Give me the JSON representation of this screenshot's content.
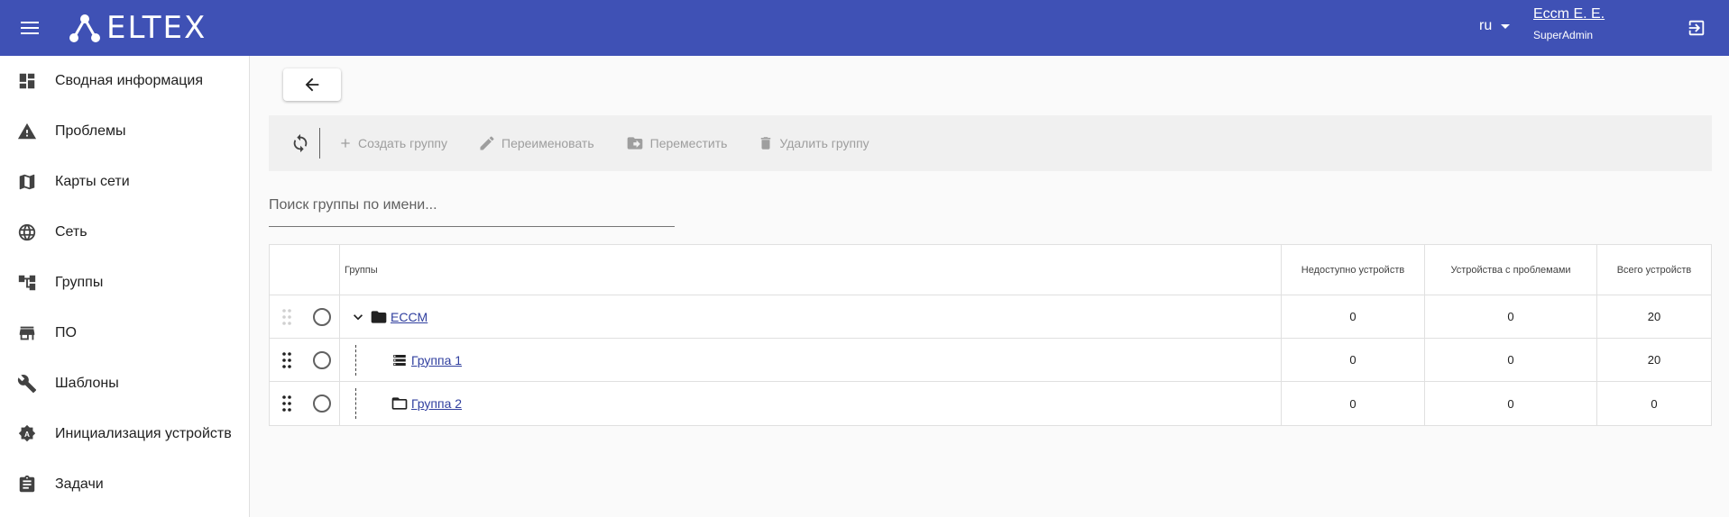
{
  "header": {
    "logo_text": "ELTEX",
    "language": "ru",
    "user_name": "Eccm E. E.",
    "user_role": "SuperAdmin"
  },
  "sidebar": {
    "items": [
      {
        "label": "Сводная информация",
        "icon": "dashboard-icon"
      },
      {
        "label": "Проблемы",
        "icon": "warning-icon"
      },
      {
        "label": "Карты сети",
        "icon": "map-icon"
      },
      {
        "label": "Сеть",
        "icon": "globe-icon"
      },
      {
        "label": "Группы",
        "icon": "groups-tree-icon"
      },
      {
        "label": "ПО",
        "icon": "store-icon"
      },
      {
        "label": "Шаблоны",
        "icon": "wrench-icon"
      },
      {
        "label": "Инициализация устройств",
        "icon": "settings-a-icon"
      },
      {
        "label": "Задачи",
        "icon": "clipboard-icon"
      }
    ]
  },
  "toolbar": {
    "create_label": "Создать группу",
    "rename_label": "Переименовать",
    "move_label": "Переместить",
    "delete_label": "Удалить группу"
  },
  "search": {
    "placeholder": "Поиск группы по имени..."
  },
  "table": {
    "headers": {
      "groups": "Группы",
      "unavailable": "Недоступно устройств",
      "problems": "Устройства с проблемами",
      "total": "Всего устройств"
    },
    "rows": [
      {
        "name": "ECCM",
        "unavailable": "0",
        "problems": "0",
        "total": "20"
      },
      {
        "name": "Группа 1",
        "unavailable": "0",
        "problems": "0",
        "total": "20"
      },
      {
        "name": "Группа 2",
        "unavailable": "0",
        "problems": "0",
        "total": "0"
      }
    ]
  }
}
